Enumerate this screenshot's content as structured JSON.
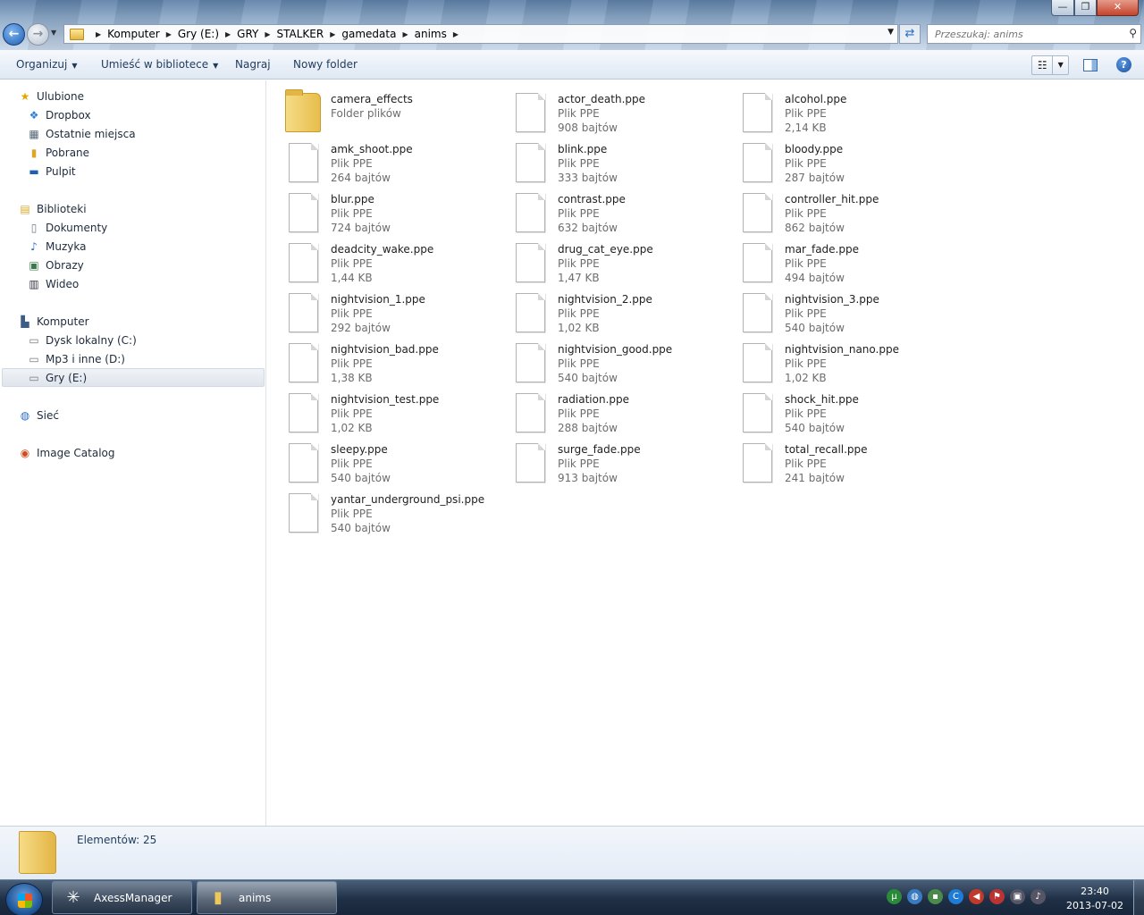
{
  "window": {
    "minimize_label": "—",
    "maximize_label": "❐",
    "close_label": "✕"
  },
  "address": {
    "crumbs": [
      "Komputer",
      "Gry (E:)",
      "GRY",
      "STALKER",
      "gamedata",
      "anims"
    ]
  },
  "search": {
    "placeholder": "Przeszukaj: anims"
  },
  "toolbar": {
    "organize": "Organizuj",
    "include": "Umieść w bibliotece",
    "burn": "Nagraj",
    "new_folder": "Nowy folder"
  },
  "nav": {
    "favorites": {
      "label": "Ulubione",
      "items": [
        "Dropbox",
        "Ostatnie miejsca",
        "Pobrane",
        "Pulpit"
      ]
    },
    "libraries": {
      "label": "Biblioteki",
      "items": [
        "Dokumenty",
        "Muzyka",
        "Obrazy",
        "Wideo"
      ]
    },
    "computer": {
      "label": "Komputer",
      "items": [
        "Dysk lokalny (C:)",
        "Mp3  i inne (D:)",
        "Gry (E:)"
      ]
    },
    "network": "Sieć",
    "image_catalog": "Image Catalog"
  },
  "files": [
    {
      "name": "camera_effects",
      "type": "Folder plików",
      "size": "",
      "folder": true
    },
    {
      "name": "actor_death.ppe",
      "type": "Plik PPE",
      "size": "908 bajtów"
    },
    {
      "name": "alcohol.ppe",
      "type": "Plik PPE",
      "size": "2,14 KB"
    },
    {
      "name": "amk_shoot.ppe",
      "type": "Plik PPE",
      "size": "264 bajtów"
    },
    {
      "name": "blink.ppe",
      "type": "Plik PPE",
      "size": "333 bajtów"
    },
    {
      "name": "bloody.ppe",
      "type": "Plik PPE",
      "size": "287 bajtów"
    },
    {
      "name": "blur.ppe",
      "type": "Plik PPE",
      "size": "724 bajtów"
    },
    {
      "name": "contrast.ppe",
      "type": "Plik PPE",
      "size": "632 bajtów"
    },
    {
      "name": "controller_hit.ppe",
      "type": "Plik PPE",
      "size": "862 bajtów"
    },
    {
      "name": "deadcity_wake.ppe",
      "type": "Plik PPE",
      "size": "1,44 KB"
    },
    {
      "name": "drug_cat_eye.ppe",
      "type": "Plik PPE",
      "size": "1,47 KB"
    },
    {
      "name": "mar_fade.ppe",
      "type": "Plik PPE",
      "size": "494 bajtów"
    },
    {
      "name": "nightvision_1.ppe",
      "type": "Plik PPE",
      "size": "292 bajtów"
    },
    {
      "name": "nightvision_2.ppe",
      "type": "Plik PPE",
      "size": "1,02 KB"
    },
    {
      "name": "nightvision_3.ppe",
      "type": "Plik PPE",
      "size": "540 bajtów"
    },
    {
      "name": "nightvision_bad.ppe",
      "type": "Plik PPE",
      "size": "1,38 KB"
    },
    {
      "name": "nightvision_good.ppe",
      "type": "Plik PPE",
      "size": "540 bajtów"
    },
    {
      "name": "nightvision_nano.ppe",
      "type": "Plik PPE",
      "size": "1,02 KB"
    },
    {
      "name": "nightvision_test.ppe",
      "type": "Plik PPE",
      "size": "1,02 KB"
    },
    {
      "name": "radiation.ppe",
      "type": "Plik PPE",
      "size": "288 bajtów"
    },
    {
      "name": "shock_hit.ppe",
      "type": "Plik PPE",
      "size": "540 bajtów"
    },
    {
      "name": "sleepy.ppe",
      "type": "Plik PPE",
      "size": "540 bajtów"
    },
    {
      "name": "surge_fade.ppe",
      "type": "Plik PPE",
      "size": "913 bajtów"
    },
    {
      "name": "total_recall.ppe",
      "type": "Plik PPE",
      "size": "241 bajtów"
    },
    {
      "name": "yantar_underground_psi.ppe",
      "type": "Plik PPE",
      "size": "540 bajtów"
    }
  ],
  "details": {
    "count": "Elementów: 25"
  },
  "taskbar": {
    "tasks": [
      "AxessManager",
      "anims"
    ],
    "time": "23:40",
    "date": "2013-07-02"
  }
}
